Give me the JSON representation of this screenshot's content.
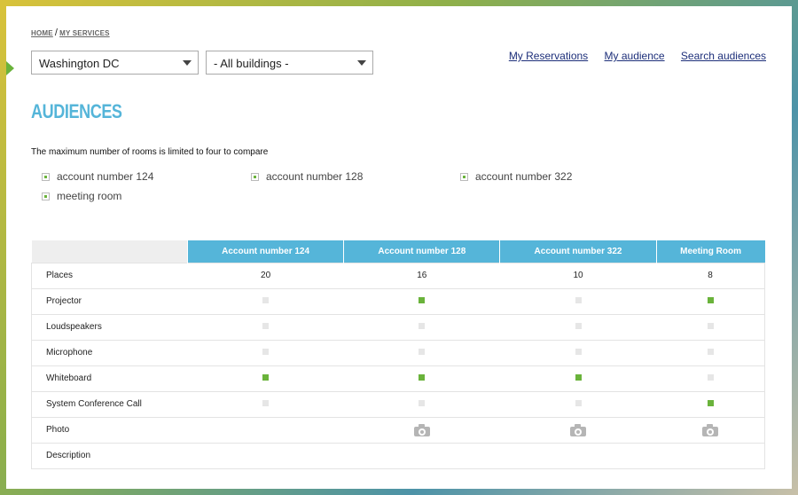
{
  "breadcrumb": {
    "home": "HOME",
    "separator": "/",
    "current": "MY SERVICES"
  },
  "filters": {
    "city": {
      "value": "Washington DC"
    },
    "building": {
      "value": "- All buildings -"
    }
  },
  "toplinks": {
    "reservations": "My Reservations",
    "audience": "My audience",
    "search": "Search audiences"
  },
  "title": "AUDIENCES",
  "notice": "The maximum number of rooms is limited to four to compare",
  "rooms": [
    {
      "label": "account number 124",
      "checked": true
    },
    {
      "label": "account number 128",
      "checked": true
    },
    {
      "label": "account number 322",
      "checked": true
    },
    {
      "label": "meeting room",
      "checked": true
    }
  ],
  "colors": {
    "accent": "#55b5d9",
    "on": "#6ab33b",
    "off": "#e6e6e6",
    "link": "#1d2f7a"
  },
  "table": {
    "columns": [
      "Account number 124",
      "Account number 128",
      "Account number 322",
      "Meeting Room"
    ],
    "rows": [
      {
        "label": "Places",
        "type": "text",
        "values": [
          "20",
          "16",
          "10",
          "8"
        ]
      },
      {
        "label": "Projector",
        "type": "bool",
        "values": [
          false,
          true,
          false,
          true
        ]
      },
      {
        "label": "Loudspeakers",
        "type": "bool",
        "values": [
          false,
          false,
          false,
          false
        ]
      },
      {
        "label": "Microphone",
        "type": "bool",
        "values": [
          false,
          false,
          false,
          false
        ]
      },
      {
        "label": "Whiteboard",
        "type": "bool",
        "values": [
          true,
          true,
          true,
          false
        ]
      },
      {
        "label": "System Conference Call",
        "type": "bool",
        "values": [
          false,
          false,
          false,
          true
        ]
      },
      {
        "label": "Photo",
        "type": "photo",
        "values": [
          false,
          true,
          true,
          true
        ],
        "icon": "camera-icon"
      },
      {
        "label": "Description",
        "type": "text",
        "values": [
          "",
          "",
          "",
          ""
        ]
      }
    ]
  }
}
